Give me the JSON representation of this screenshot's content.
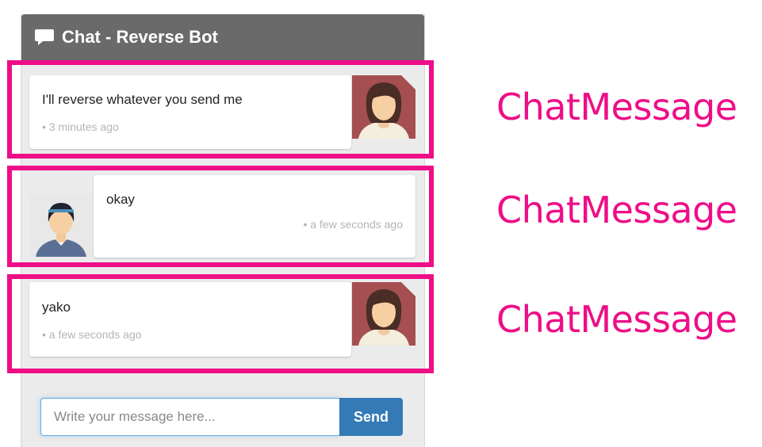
{
  "header": {
    "title": "Chat - Reverse Bot",
    "icon": "comment-icon"
  },
  "messages": [
    {
      "text": "I'll reverse whatever you send me",
      "time": "• 3 minutes ago",
      "sender": "bot"
    },
    {
      "text": "okay",
      "time": "• a few seconds ago",
      "sender": "user"
    },
    {
      "text": "yako",
      "time": "• a few seconds ago",
      "sender": "bot"
    }
  ],
  "annotation": {
    "label": "ChatMessage",
    "color": "#ee0e87"
  },
  "composer": {
    "placeholder": "Write your message here...",
    "send_label": "Send"
  },
  "colors": {
    "header": "#6a6a6a",
    "send_button": "#337ab7",
    "highlight": "#ee0e87"
  }
}
